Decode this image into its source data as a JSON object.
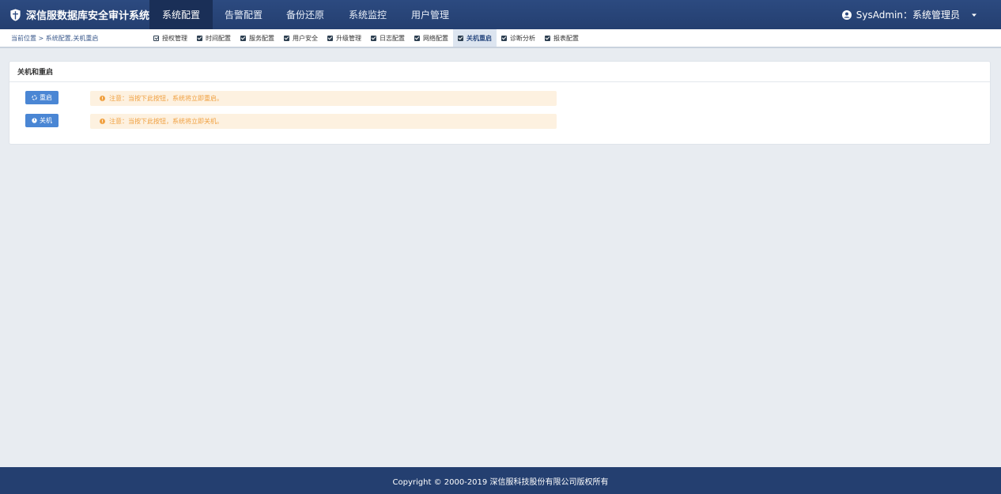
{
  "app": {
    "title": "深信服数据库安全审计系统"
  },
  "nav": {
    "items": [
      {
        "label": "系统配置"
      },
      {
        "label": "告警配置"
      },
      {
        "label": "备份还原"
      },
      {
        "label": "系统监控"
      },
      {
        "label": "用户管理"
      }
    ]
  },
  "user": {
    "label": "SysAdmin：系统管理员"
  },
  "breadcrumb": {
    "text": "当前位置 > 系统配置,关机重启"
  },
  "tabs": [
    {
      "label": "授权管理"
    },
    {
      "label": "时间配置"
    },
    {
      "label": "服务配置"
    },
    {
      "label": "用户安全"
    },
    {
      "label": "升级管理"
    },
    {
      "label": "日志配置"
    },
    {
      "label": "网络配置"
    },
    {
      "label": "关机重启"
    },
    {
      "label": "诊断分析"
    },
    {
      "label": "报表配置"
    }
  ],
  "panel": {
    "title": "关机和重启",
    "restart_label": "重启",
    "shutdown_label": "关机",
    "restart_notice": "注意：当按下此按钮，系统将立即重启。",
    "shutdown_notice": "注意：当按下此按钮，系统将立即关机。"
  },
  "footer": {
    "copyright": "Copyright © 2000-2019 深信服科技股份有限公司版权所有"
  },
  "colors": {
    "topbar": "#243f70",
    "button": "#4a86d4",
    "notice_bg": "#fdf1e0",
    "notice_text": "#f0a040"
  }
}
